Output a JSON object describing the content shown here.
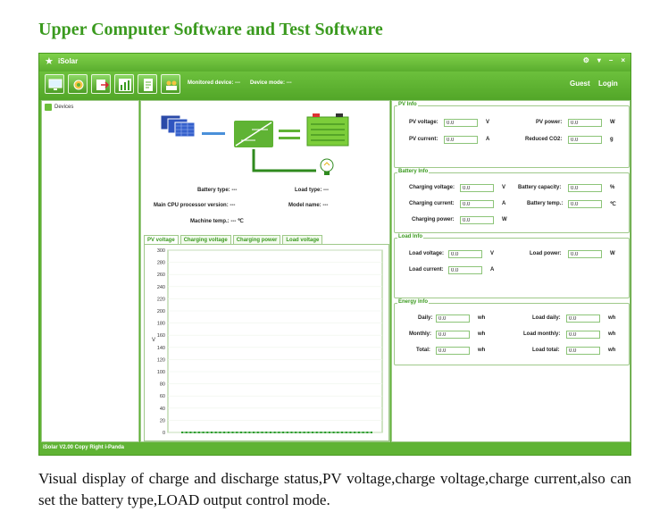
{
  "heading": "Upper Computer Software and Test Software",
  "caption": "Visual display of charge and discharge status,PV voltage,charge voltage,charge current,also can set the battery type,LOAD output control mode.",
  "app": {
    "name": "iSolar",
    "window_controls": [
      "⚙",
      "▾",
      "–",
      "×"
    ],
    "monitored_device_label": "Monitored device: ---",
    "device_mode_label": "Device mode: ---",
    "user": "Guest",
    "login": "Login",
    "toolbar_icons": [
      "monitor-icon",
      "settings-icon",
      "export-icon",
      "chart-icon",
      "document-icon",
      "users-icon"
    ],
    "status": "iSolar V2.00   Copy Right i-Panda"
  },
  "sidebar": {
    "devices": "Devices"
  },
  "system_info": {
    "battery_type": "Battery type: ---",
    "load_type": "Load type: ---",
    "cpu_version": "Main CPU processor version: ---",
    "model_name": "Model name: ---",
    "machine_temp": "Machine temp.: --- ℃"
  },
  "tabs": [
    "PV voltage",
    "Charging voltage",
    "Charging power",
    "Load voltage"
  ],
  "active_tab": 0,
  "pv_info": {
    "title": "PV Info",
    "pv_voltage": {
      "label": "PV voltage:",
      "value": "0.0",
      "unit": "V"
    },
    "pv_power": {
      "label": "PV power:",
      "value": "0.0",
      "unit": "W"
    },
    "pv_current": {
      "label": "PV current:",
      "value": "0.0",
      "unit": "A"
    },
    "reduced_co2": {
      "label": "Reduced CO2:",
      "value": "0.0",
      "unit": "g"
    }
  },
  "battery_info": {
    "title": "Battery Info",
    "charging_voltage": {
      "label": "Charging voltage:",
      "value": "0.0",
      "unit": "V"
    },
    "battery_capacity": {
      "label": "Battery capacity:",
      "value": "0.0",
      "unit": "%"
    },
    "charging_current": {
      "label": "Charging current:",
      "value": "0.0",
      "unit": "A"
    },
    "battery_temp": {
      "label": "Battery temp.:",
      "value": "0.0",
      "unit": "℃"
    },
    "charging_power": {
      "label": "Charging power:",
      "value": "0.0",
      "unit": "W"
    }
  },
  "load_info": {
    "title": "Load Info",
    "load_voltage": {
      "label": "Load voltage:",
      "value": "0.0",
      "unit": "V"
    },
    "load_power": {
      "label": "Load power:",
      "value": "0.0",
      "unit": "W"
    },
    "load_current": {
      "label": "Load current:",
      "value": "0.0",
      "unit": "A"
    }
  },
  "energy_info": {
    "title": "Energy Info",
    "daily": {
      "label": "Daily:",
      "value": "0.0",
      "unit": "wh"
    },
    "load_daily": {
      "label": "Load daily:",
      "value": "0.0",
      "unit": "wh"
    },
    "monthly": {
      "label": "Monthly:",
      "value": "0.0",
      "unit": "wh"
    },
    "load_monthly": {
      "label": "Load monthly:",
      "value": "0.0",
      "unit": "wh"
    },
    "total": {
      "label": "Total:",
      "value": "0.0",
      "unit": "wh"
    },
    "load_total": {
      "label": "Load total:",
      "value": "0.0",
      "unit": "wh"
    }
  },
  "colors": {
    "brand_green": "#5fb334",
    "title_green": "#3a9a1e",
    "series_green": "#2a9a2a"
  },
  "chart_data": {
    "type": "line",
    "ylabel": "V",
    "ylim": [
      0,
      300
    ],
    "y_ticks": [
      "0",
      "20",
      "40",
      "60",
      "80",
      "100",
      "120",
      "140",
      "160",
      "180",
      "200",
      "220",
      "240",
      "260",
      "280",
      "300"
    ],
    "series": [
      {
        "values": [
          0,
          0,
          0,
          0,
          0,
          0,
          0,
          0,
          0,
          0,
          0,
          0,
          0,
          0,
          0,
          0,
          0,
          0,
          0,
          0,
          0,
          0,
          0,
          0,
          0,
          0,
          0,
          0,
          0,
          0,
          0,
          0,
          0,
          0,
          0,
          0,
          0,
          0,
          0,
          0,
          0,
          0,
          0,
          0,
          0,
          0
        ]
      }
    ],
    "grid": true
  }
}
